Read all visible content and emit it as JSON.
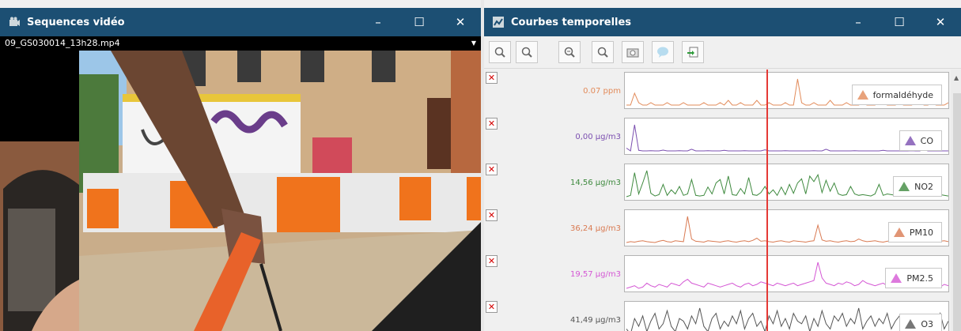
{
  "video_window": {
    "title": "Sequences vidéo",
    "icon": "video-camera-icon",
    "file_name": "09_GS030014_13h28.mp4",
    "buttons": {
      "minimize": "–",
      "maximize": "☐",
      "close": "✕"
    }
  },
  "curves_window": {
    "title": "Courbes temporelles",
    "icon": "chart-icon",
    "buttons": {
      "minimize": "–",
      "maximize": "☐",
      "close": "✕"
    },
    "toolbar": [
      "zoom-in-icon",
      "zoom-out-icon",
      "zoom-area-icon",
      "zoom-reset-icon",
      "snapshot-icon",
      "comment-icon",
      "export-icon"
    ],
    "delete_label": "✕",
    "accent_cursor_color": "#e53935",
    "scroll_up": "▲"
  },
  "chart_data": [
    {
      "type": "line",
      "series": [
        {
          "name": "formaldéhyde",
          "color": "#e28b5a",
          "values": [
            0.01,
            0.01,
            0.06,
            0.02,
            0.01,
            0.01,
            0.02,
            0.01,
            0.01,
            0.01,
            0.02,
            0.01,
            0.01,
            0.01,
            0.02,
            0.01,
            0.01,
            0.01,
            0.01,
            0.02,
            0.01,
            0.01,
            0.01,
            0.02,
            0.01,
            0.03,
            0.01,
            0.01,
            0.02,
            0.01,
            0.01,
            0.01,
            0.03,
            0.01,
            0.01,
            0.02,
            0.01,
            0.01,
            0.01,
            0.02,
            0.01,
            0.01,
            0.12,
            0.02,
            0.01,
            0.01,
            0.02,
            0.01,
            0.01,
            0.01,
            0.03,
            0.01,
            0.01,
            0.01,
            0.02,
            0.01,
            0.01,
            0.01,
            0.02,
            0.01,
            0.01,
            0.01,
            0.06,
            0.02,
            0.01,
            0.01,
            0.01,
            0.02,
            0.01,
            0.01,
            0.01,
            0.02,
            0.05,
            0.01,
            0.01,
            0.02,
            0.01,
            0.01,
            0.01,
            0.02
          ]
        }
      ],
      "current_value": "0.07 ppm",
      "legend_marker": "triangle"
    },
    {
      "type": "line",
      "series": [
        {
          "name": "CO",
          "color": "#7b4fb0",
          "values": [
            0.1,
            0.0,
            0.95,
            0.02,
            0.0,
            0.0,
            0.01,
            0.0,
            0.0,
            0.03,
            0.0,
            0.0,
            0.0,
            0.01,
            0.0,
            0.0,
            0.06,
            0.0,
            0.0,
            0.0,
            0.01,
            0.0,
            0.0,
            0.0,
            0.02,
            0.0,
            0.0,
            0.0,
            0.0,
            0.01,
            0.0,
            0.0,
            0.0,
            0.0,
            0.04,
            0.0,
            0.0,
            0.0,
            0.0,
            0.01,
            0.0,
            0.0,
            0.0,
            0.0,
            0.0,
            0.0,
            0.01,
            0.0,
            0.0,
            0.06,
            0.0,
            0.0,
            0.0,
            0.0,
            0.0,
            0.0,
            0.01,
            0.0,
            0.0,
            0.0,
            0.0,
            0.0,
            0.0,
            0.02,
            0.0,
            0.0,
            0.0,
            0.0,
            0.0,
            0.0,
            0.01,
            0.0,
            0.0,
            0.05,
            0.0,
            0.0,
            0.0,
            0.0,
            0.0,
            0.0
          ]
        }
      ],
      "current_value": "0,00 µg/m3",
      "legend_marker": "triangle"
    },
    {
      "type": "line",
      "series": [
        {
          "name": "NO2",
          "color": "#3f8a3f",
          "values": [
            10,
            12,
            45,
            14,
            30,
            48,
            15,
            11,
            13,
            28,
            12,
            20,
            14,
            25,
            12,
            14,
            35,
            12,
            11,
            12,
            24,
            14,
            30,
            35,
            14,
            40,
            13,
            12,
            22,
            14,
            38,
            13,
            12,
            16,
            25,
            14,
            20,
            12,
            24,
            13,
            28,
            15,
            30,
            36,
            14,
            40,
            32,
            42,
            16,
            34,
            18,
            30,
            14,
            12,
            13,
            25,
            14,
            12,
            13,
            12,
            11,
            14,
            28,
            12,
            14,
            13,
            12,
            12,
            11,
            13,
            12,
            11,
            13,
            14,
            12,
            11,
            12,
            13,
            12,
            11
          ]
        }
      ],
      "current_value": "14,56 µg/m3",
      "legend_marker": "triangle"
    },
    {
      "type": "line",
      "series": [
        {
          "name": "PM10",
          "color": "#d97a52",
          "values": [
            30,
            32,
            31,
            33,
            34,
            32,
            31,
            30,
            33,
            35,
            32,
            31,
            34,
            33,
            32,
            90,
            38,
            33,
            32,
            31,
            34,
            33,
            32,
            31,
            33,
            34,
            32,
            31,
            33,
            34,
            32,
            35,
            40,
            33,
            34,
            32,
            31,
            33,
            34,
            32,
            31,
            34,
            33,
            32,
            31,
            33,
            34,
            70,
            36,
            33,
            34,
            32,
            31,
            33,
            34,
            32,
            33,
            38,
            34,
            32,
            33,
            34,
            32,
            31,
            33,
            34,
            32,
            33,
            34,
            32,
            31,
            33,
            34,
            32,
            33,
            34,
            32,
            33,
            34,
            32
          ]
        }
      ],
      "current_value": "36,24 µg/m3",
      "legend_marker": "triangle"
    },
    {
      "type": "line",
      "series": [
        {
          "name": "PM2.5",
          "color": "#d457d4",
          "values": [
            18,
            19,
            20,
            18,
            19,
            22,
            20,
            19,
            21,
            20,
            19,
            22,
            21,
            20,
            23,
            25,
            22,
            21,
            20,
            19,
            22,
            21,
            20,
            19,
            20,
            21,
            22,
            20,
            19,
            21,
            22,
            20,
            21,
            23,
            22,
            21,
            20,
            22,
            21,
            20,
            21,
            22,
            20,
            21,
            22,
            23,
            24,
            38,
            26,
            22,
            21,
            20,
            22,
            21,
            23,
            22,
            20,
            21,
            24,
            22,
            21,
            20,
            21,
            22,
            20,
            21,
            19,
            20,
            21,
            22,
            20,
            19,
            21,
            20,
            22,
            21,
            20,
            19,
            21,
            20
          ]
        }
      ],
      "current_value": "19,57 µg/m3",
      "legend_marker": "triangle"
    },
    {
      "type": "line",
      "series": [
        {
          "name": "O3",
          "color": "#555555",
          "values": [
            40,
            38,
            44,
            41,
            45,
            39,
            43,
            46,
            40,
            42,
            47,
            41,
            39,
            44,
            43,
            40,
            45,
            42,
            48,
            41,
            39,
            44,
            46,
            40,
            43,
            41,
            45,
            42,
            47,
            40,
            44,
            46,
            41,
            43,
            39,
            45,
            42,
            47,
            41,
            44,
            40,
            46,
            43,
            42,
            45,
            39,
            44,
            41,
            47,
            42,
            40,
            45,
            43,
            46,
            41,
            44,
            42,
            48,
            40,
            43,
            45,
            41,
            44,
            42,
            46,
            40,
            43,
            45,
            41,
            44,
            42,
            40,
            45,
            43,
            41,
            44,
            42,
            46,
            40,
            43
          ]
        }
      ],
      "current_value": "41,49 µg/m3",
      "legend_marker": "triangle"
    }
  ]
}
